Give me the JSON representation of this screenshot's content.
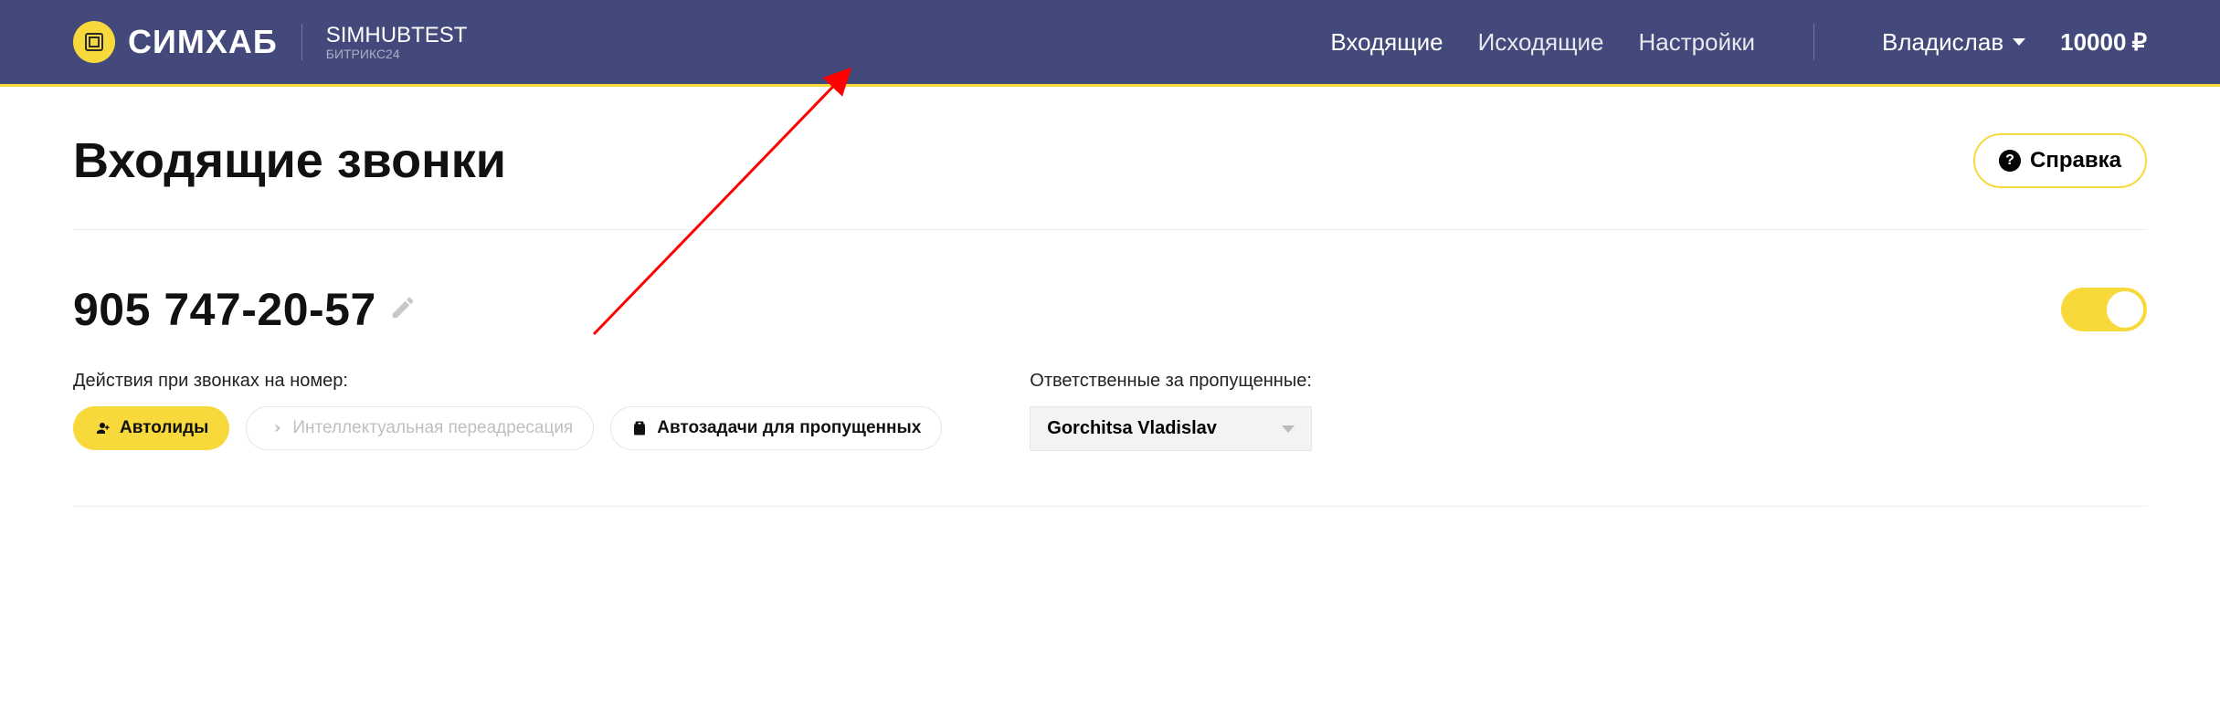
{
  "header": {
    "brand": "СИМХАБ",
    "account_title": "SIMHUBTEST",
    "account_sub": "БИТРИКС24",
    "nav": {
      "incoming": "Входящие",
      "outgoing": "Исходящие",
      "settings": "Настройки"
    },
    "user_name": "Владислав",
    "balance_value": "10000",
    "balance_currency": "₽"
  },
  "page": {
    "title": "Входящие звонки",
    "help_label": "Справка"
  },
  "line": {
    "phone": "905 747-20-57",
    "enabled": true
  },
  "actions": {
    "label": "Действия при звонках на номер:",
    "autoleads": "Автолиды",
    "smart_redirect": "Интеллектуальная переадресация",
    "autotasks": "Автозадачи для пропущенных"
  },
  "responsible": {
    "label": "Ответственные за пропущенные:",
    "selected": "Gorchitsa Vladislav"
  }
}
